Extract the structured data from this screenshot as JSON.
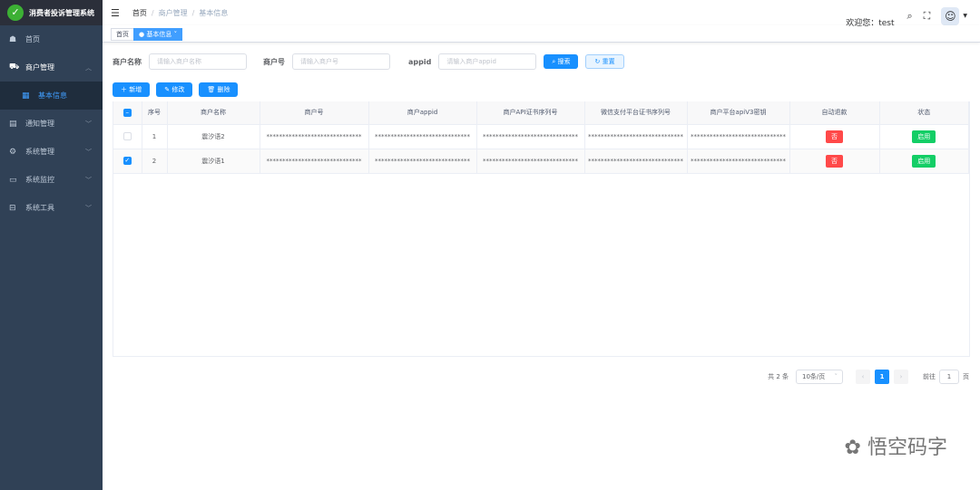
{
  "app": {
    "title": "消费者投诉管理系统"
  },
  "sidebar": {
    "items": [
      {
        "label": "首页",
        "icon": "dashboard-icon"
      },
      {
        "label": "商户管理",
        "icon": "shop-icon",
        "expanded": true
      },
      {
        "label": "基本信息",
        "icon": "table-icon",
        "active": true
      },
      {
        "label": "通知管理",
        "icon": "message-icon"
      },
      {
        "label": "系统管理",
        "icon": "gear-icon"
      },
      {
        "label": "系统监控",
        "icon": "monitor-icon"
      },
      {
        "label": "系统工具",
        "icon": "tool-icon"
      }
    ]
  },
  "header": {
    "breadcrumb": [
      "首页",
      "商户管理",
      "基本信息"
    ],
    "welcome": "欢迎您：test"
  },
  "tags": [
    "首页",
    "基本信息"
  ],
  "search": {
    "name_label": "商户名称",
    "name_placeholder": "请输入商户名称",
    "no_label": "商户号",
    "no_placeholder": "请输入商户号",
    "appid_label": "appid",
    "appid_placeholder": "请输入商户appid",
    "search_btn": "搜索",
    "reset_btn": "重置"
  },
  "toolbar": {
    "add": "新增",
    "edit": "修改",
    "delete": "删除"
  },
  "table": {
    "columns": [
      "序号",
      "商户名称",
      "商户号",
      "商户appid",
      "商户API证书序列号",
      "微信支付平台证书序列号",
      "商户平台apiV3密钥",
      "自动退款",
      "状态"
    ],
    "rows": [
      {
        "checked": false,
        "index": "1",
        "name": "震汐语2",
        "mchid": "******************************",
        "appid": "******************************",
        "api_serial": "******************************",
        "wx_serial": "******************************",
        "apiv3": "******************************",
        "refund": "否",
        "status": "启用"
      },
      {
        "checked": true,
        "index": "2",
        "name": "震汐语1",
        "mchid": "******************************",
        "appid": "******************************",
        "api_serial": "******************************",
        "wx_serial": "******************************",
        "apiv3": "******************************",
        "refund": "否",
        "status": "启用"
      }
    ]
  },
  "pagination": {
    "total": "共 2 条",
    "page_size": "10条/页",
    "current": "1",
    "goto_label": "前往",
    "goto_value": "1",
    "page_unit": "页"
  },
  "watermark": "悟空码字",
  "colors": {
    "primary": "#1890ff",
    "sidebar": "#304156",
    "danger": "#ff4949",
    "success": "#13ce66"
  }
}
